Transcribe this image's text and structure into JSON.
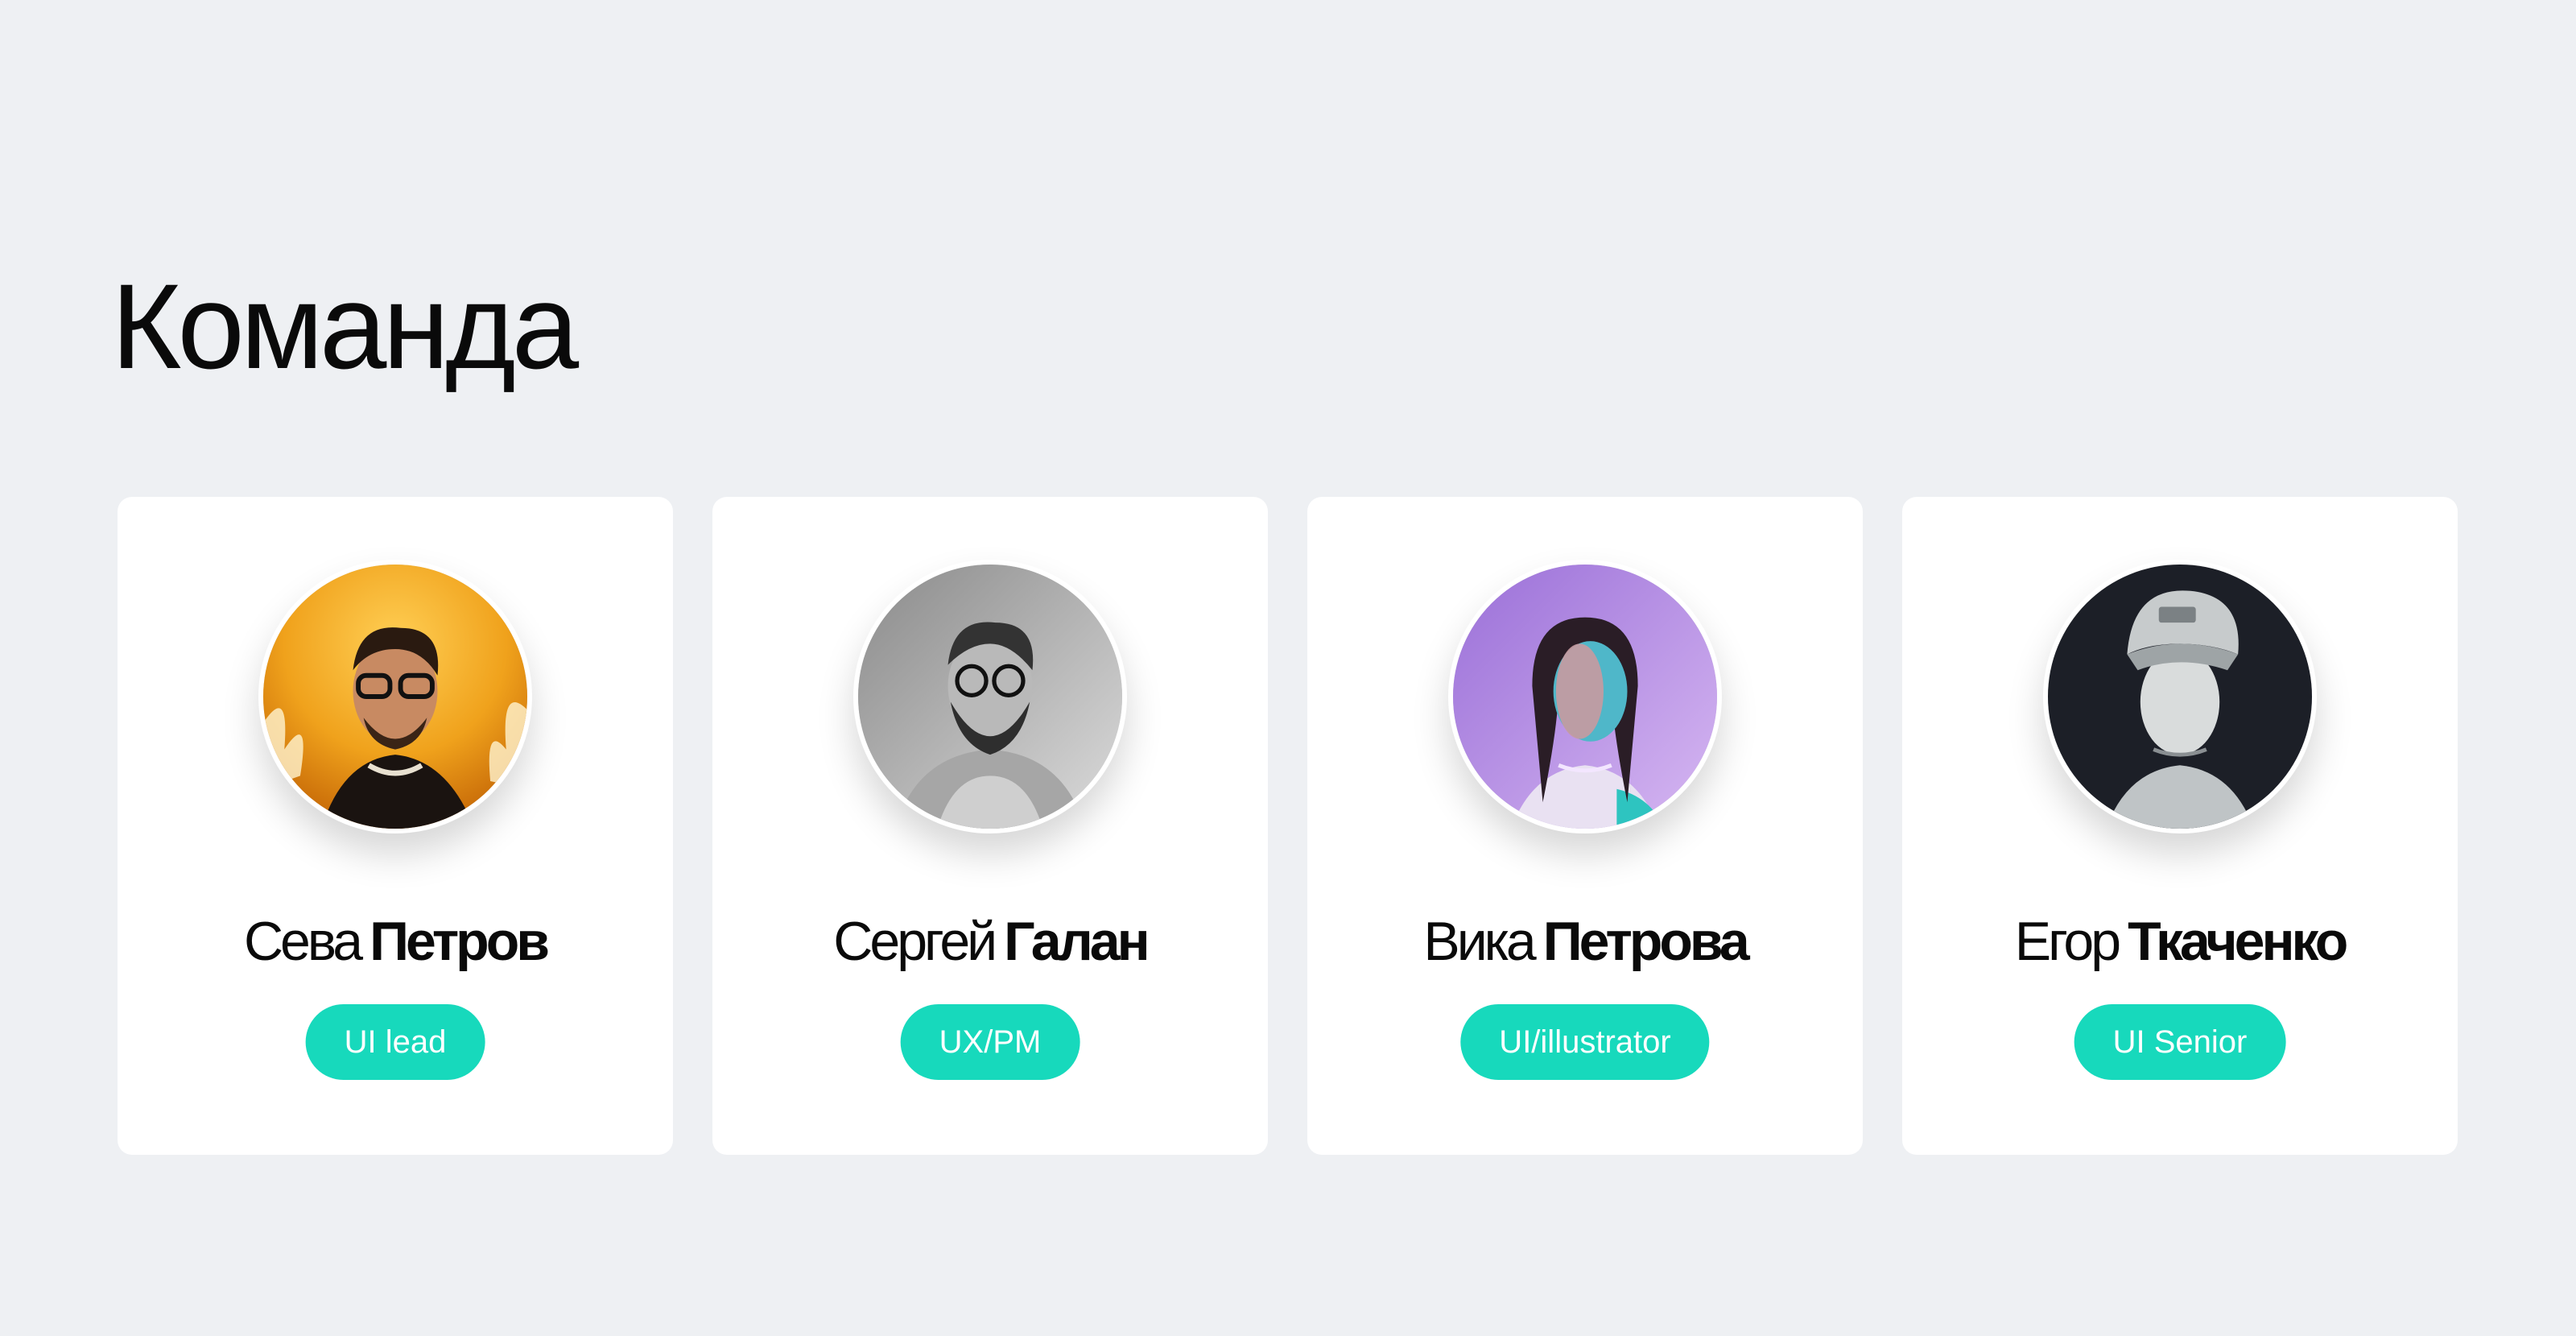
{
  "page": {
    "title": "Команда",
    "background": "#eef0f3"
  },
  "team": [
    {
      "first_name": "Сева",
      "last_name": "Петров",
      "role": "UI lead",
      "avatar_icon": "avatar-photo-orange",
      "avatar_tone": "#f0a21c"
    },
    {
      "first_name": "Сергей",
      "last_name": "Галан",
      "role": "UX/PM",
      "avatar_icon": "avatar-photo-grayscale",
      "avatar_tone": "#9a9a9a"
    },
    {
      "first_name": "Вика",
      "last_name": "Петрова",
      "role": "UI/illustrator",
      "avatar_icon": "avatar-photo-purple",
      "avatar_tone": "#b98de6"
    },
    {
      "first_name": "Егор",
      "last_name": "Ткаченко",
      "role": "UI Senior",
      "avatar_icon": "avatar-photo-dark",
      "avatar_tone": "#1c1f27"
    }
  ],
  "colors": {
    "accent": "#17d9bc",
    "card": "#ffffff",
    "text": "#0a0a0a"
  }
}
